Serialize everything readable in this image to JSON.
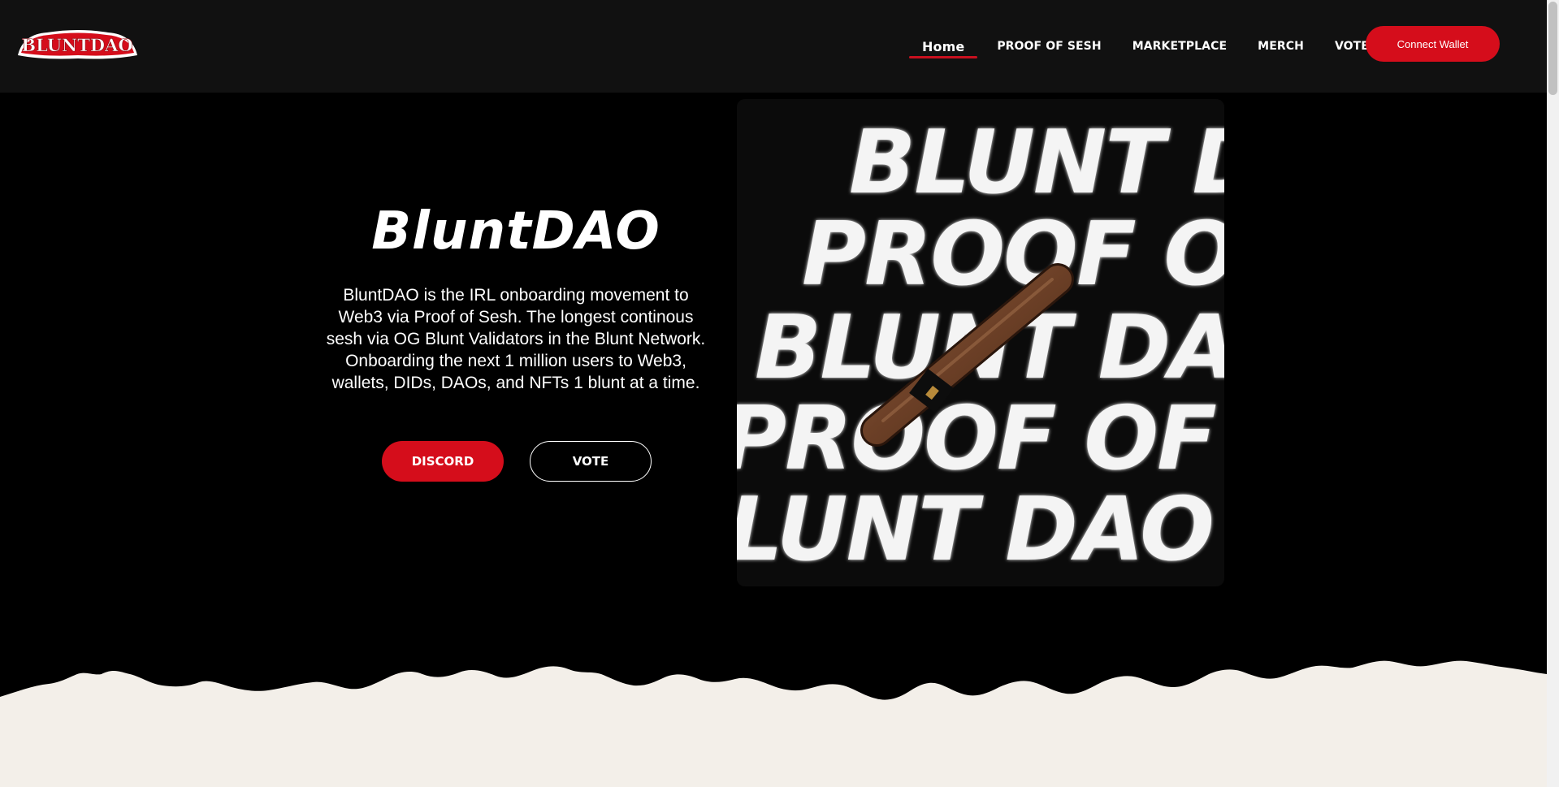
{
  "brand": {
    "logo_text": "BLUNTDAO",
    "colors": {
      "accent": "#d50d1b",
      "header_bg": "#111111",
      "hero_bg": "#000000",
      "paper": "#f3efe9"
    }
  },
  "nav": {
    "items": [
      {
        "label": "Home",
        "active": true
      },
      {
        "label": "PROOF OF SESH",
        "active": false
      },
      {
        "label": "MARKETPLACE",
        "active": false
      },
      {
        "label": "MERCH",
        "active": false
      },
      {
        "label": "VOTE",
        "active": false
      }
    ],
    "connect_wallet": "Connect Wallet"
  },
  "hero": {
    "title": "BluntDAO",
    "description": "BluntDAO is the IRL onboarding movement to Web3 via Proof of Sesh. The longest continous sesh via OG Blunt Validators in the Blunt Network. Onboarding the next 1 million users to Web3, wallets, DIDs, DAOs, and NFTs 1 blunt at a time.",
    "buttons": {
      "discord": "DISCORD",
      "vote": "VOTE"
    },
    "art_lines": [
      "BLUNT DA",
      "PROOF  OF",
      "BLUNT DAO",
      "PROOF  OF  S",
      "LUNT DAO BL"
    ]
  }
}
